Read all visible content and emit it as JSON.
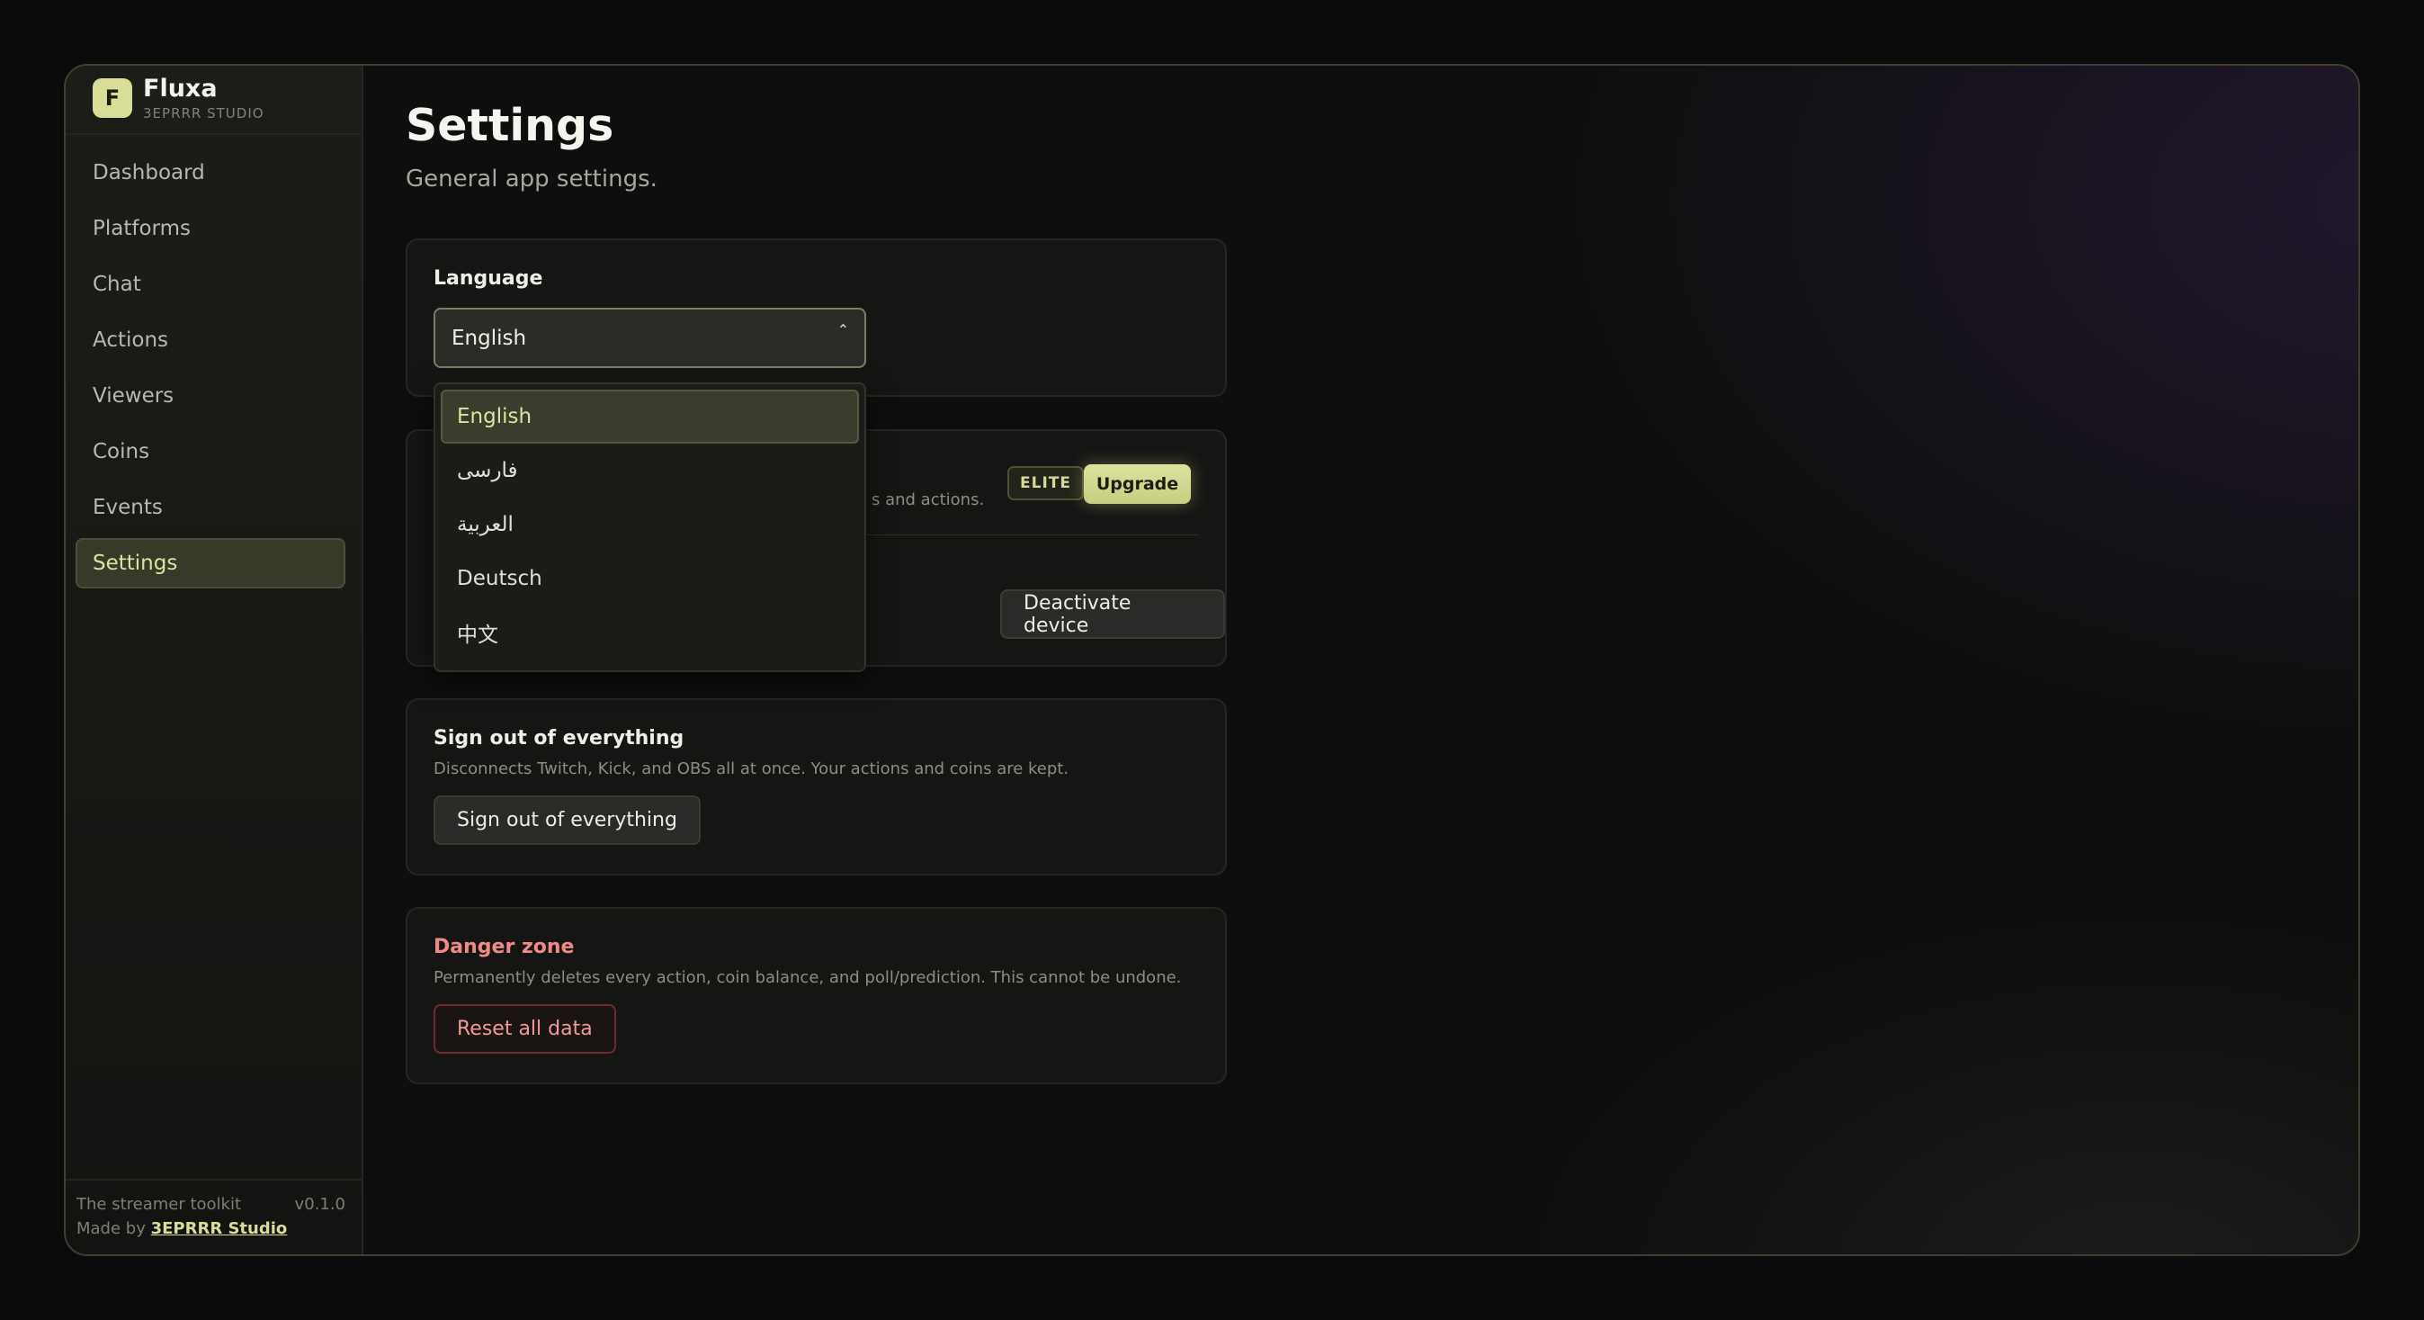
{
  "brand": {
    "logo": "F",
    "name": "Fluxa",
    "subtitle": "3EPRRR STUDIO"
  },
  "sidebar": {
    "items": [
      {
        "label": "Dashboard"
      },
      {
        "label": "Platforms"
      },
      {
        "label": "Chat"
      },
      {
        "label": "Actions"
      },
      {
        "label": "Viewers"
      },
      {
        "label": "Coins"
      },
      {
        "label": "Events"
      },
      {
        "label": "Settings",
        "active": true
      }
    ],
    "footer": {
      "tagline": "The streamer toolkit",
      "version": "v0.1.0",
      "made_by_prefix": "Made by",
      "made_by_link": "3EPRRR Studio"
    }
  },
  "page": {
    "title": "Settings",
    "subtitle": "General app settings."
  },
  "language": {
    "label": "Language",
    "selected": "English",
    "options": [
      "English",
      "فارسی",
      "العربية",
      "Deutsch",
      "中文"
    ]
  },
  "license": {
    "description_partial": "s and actions.",
    "badge": "ELITE",
    "upgrade_label": "Upgrade",
    "deactivate_label": "Deactivate device"
  },
  "signout": {
    "title": "Sign out of everything",
    "description": "Disconnects Twitch, Kick, and OBS all at once. Your actions and coins are kept.",
    "button": "Sign out of everything"
  },
  "danger": {
    "title": "Danger zone",
    "description": "Permanently deletes every action, coin balance, and poll/prediction. This cannot be undone.",
    "button": "Reset all data"
  },
  "colors": {
    "accent": "#d8dd98",
    "danger": "#f08a8a",
    "background": "#0d0e0d"
  }
}
